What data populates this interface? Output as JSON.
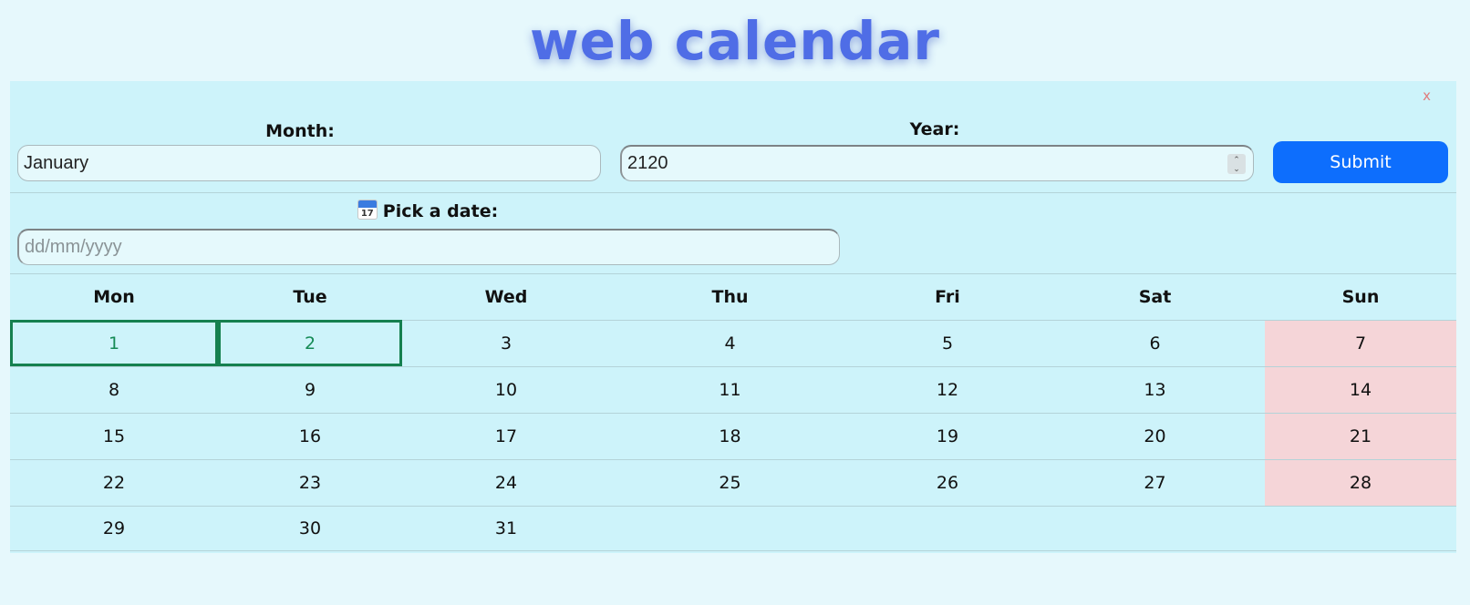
{
  "header": {
    "title": "web calendar"
  },
  "form": {
    "close_label": "x",
    "month_label": "Month:",
    "month_value": "January",
    "year_label": "Year:",
    "year_value": "2120",
    "submit_label": "Submit",
    "date_label": "Pick a date:",
    "date_icon": "calendar-icon",
    "date_icon_text": "17",
    "date_placeholder": "dd/mm/yyyy"
  },
  "calendar": {
    "weekdays": [
      "Mon",
      "Tue",
      "Wed",
      "Thu",
      "Fri",
      "Sat",
      "Sun"
    ],
    "weeks": [
      [
        "1",
        "2",
        "3",
        "4",
        "5",
        "6",
        "7"
      ],
      [
        "8",
        "9",
        "10",
        "11",
        "12",
        "13",
        "14"
      ],
      [
        "15",
        "16",
        "17",
        "18",
        "19",
        "20",
        "21"
      ],
      [
        "22",
        "23",
        "24",
        "25",
        "26",
        "27",
        "28"
      ],
      [
        "29",
        "30",
        "31",
        "",
        "",
        "",
        ""
      ]
    ],
    "selected_days": [
      "1",
      "2"
    ]
  },
  "colors": {
    "title": "#4f6de6",
    "panel_bg": "#cdf3fa",
    "sunday_bg": "#f5d5d8",
    "selected_border": "#15804f",
    "submit_bg": "#0d6efd"
  }
}
